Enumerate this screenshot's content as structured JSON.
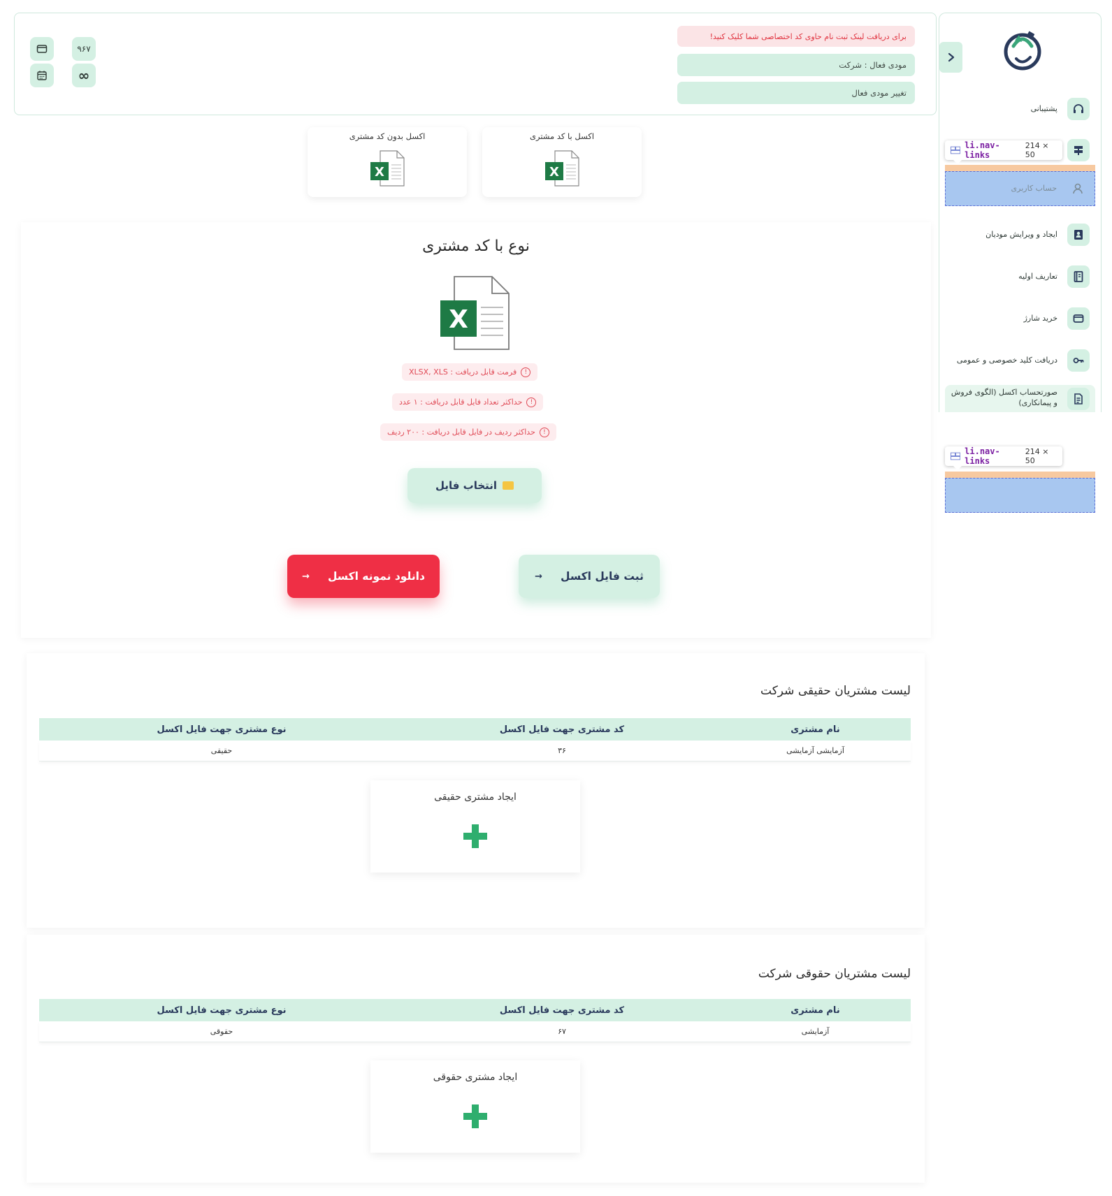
{
  "header": {
    "alert_text": "برای دریافت لینک ثبت نام حاوی کد اختصاصی شما کلیک کنید!",
    "active_taxpayer": "مودی فعال : شرکت",
    "change_taxpayer": "تغییر مودی فعال",
    "charge_count": "۹۶۷",
    "infinity_symbol": "∞"
  },
  "sidebar": {
    "items": [
      {
        "label": "پشتیبانی",
        "icon": "headset-icon"
      },
      {
        "label": "",
        "icon": "signpost-icon"
      },
      {
        "label": "حساب کاربری",
        "icon": "user-icon"
      },
      {
        "label": "ایجاد و ویرایش مودیان",
        "icon": "contact-book-icon"
      },
      {
        "label": "تعاریف اولیه",
        "icon": "book-icon"
      },
      {
        "label": "خرید شارژ",
        "icon": "wallet-icon"
      },
      {
        "label": "دریافت کلید خصوصی و عمومی",
        "icon": "key-icon"
      },
      {
        "label": "صورتحساب اکسل (الگوی فروش و پیمانکاری)",
        "icon": "document-icon"
      }
    ],
    "devtools_tooltip": {
      "selector": "li.nav-links",
      "size": "214 × 50"
    }
  },
  "excel_options": [
    {
      "label": "اکسل با کد مشتری"
    },
    {
      "label": "اکسل بدون کد مشتری"
    }
  ],
  "upload": {
    "title": "نوع با کد مشتری",
    "info": [
      "فرمت قابل دریافت : XLSX, XLS",
      "حداکثر تعداد فایل قابل دریافت : ۱ عدد",
      "حداکثر ردیف در فایل قابل دریافت : ۲۰۰ ردیف"
    ],
    "choose_file": "انتخاب فایل",
    "submit_excel": "ثبت فایل اکسل",
    "download_sample": "دانلود نمونه اکسل",
    "arrow": "→"
  },
  "real_customers": {
    "title": "لیست مشتریان حقیقی شرکت",
    "columns": [
      "نام مشتری",
      "کد مشتری جهت فایل اکسل",
      "نوع مشتری جهت فایل اکسل"
    ],
    "rows": [
      [
        "آزمایشی آزمایشی",
        "۳۶",
        "حقیقی"
      ]
    ],
    "add_label": "ایجاد مشتری حقیقی"
  },
  "legal_customers": {
    "title": "لیست مشتریان حقوقی شرکت",
    "columns": [
      "نام مشتری",
      "کد مشتری جهت فایل اکسل",
      "نوع مشتری جهت فایل اکسل"
    ],
    "rows": [
      [
        "آزمایشی",
        "۶۷",
        "حقوقی"
      ]
    ],
    "add_label": "ایجاد مشتری حقوقی"
  },
  "colors": {
    "accent_mint": "#d4f0e3",
    "danger_red": "#ef2f45",
    "excel_green": "#1e7a45",
    "plus_green": "#2fae6e"
  }
}
